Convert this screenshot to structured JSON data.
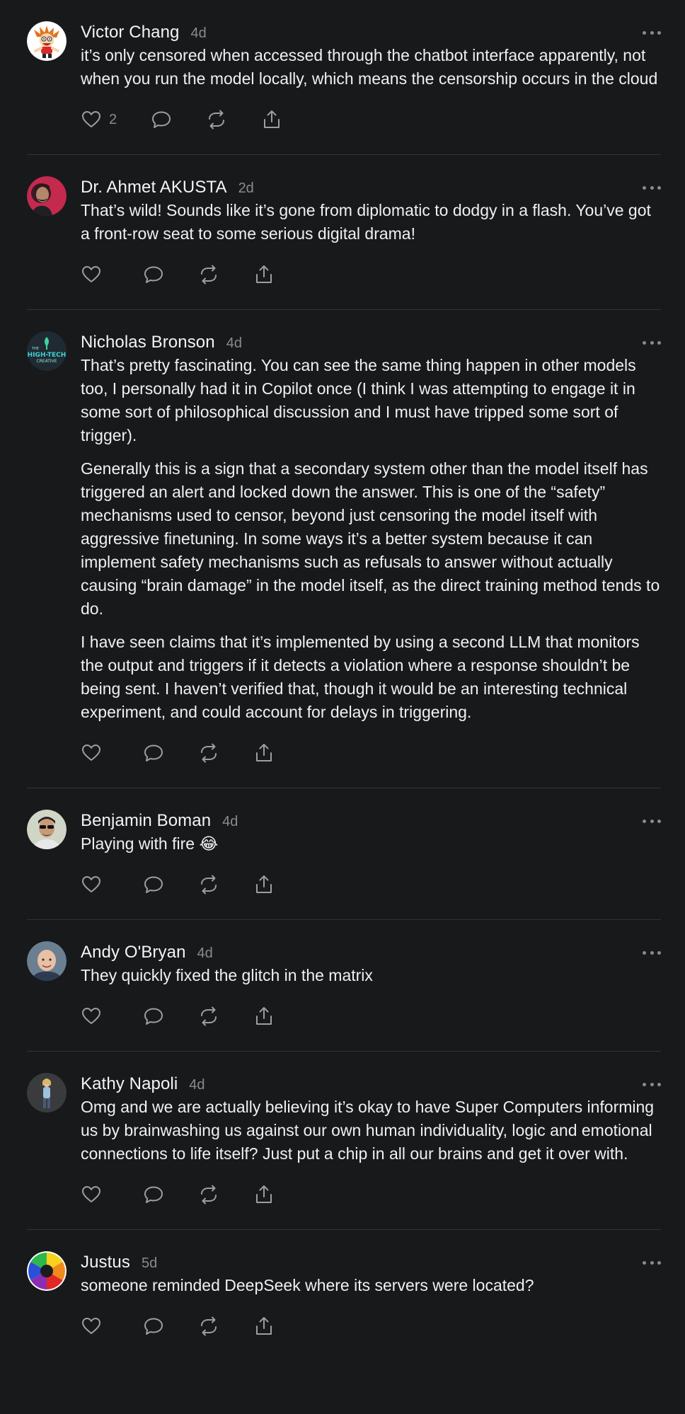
{
  "comments": [
    {
      "author": "Victor Chang",
      "time": "4d",
      "paragraphs": [
        "it’s only censored when accessed through the chatbot interface apparently, not when you run the model locally, which means the censorship occurs in the cloud"
      ],
      "likes": "2",
      "avatar_icon": "cartoon-character-avatar"
    },
    {
      "author": "Dr. Ahmet AKUSTA",
      "time": "2d",
      "paragraphs": [
        "That’s wild! Sounds like it’s gone from diplomatic to dodgy in a flash. You’ve got a front-row seat to some serious digital drama!"
      ],
      "likes": "",
      "avatar_icon": "person-photo-avatar"
    },
    {
      "author": "Nicholas Bronson",
      "time": "4d",
      "paragraphs": [
        "That’s pretty fascinating. You can see the same thing happen in other models too, I personally had it in Copilot once (I think I was attempting to engage it in some sort of philosophical discussion and I must have tripped some sort of trigger).",
        "Generally this is a sign that a secondary system other than the model itself has triggered an alert and locked down the answer. This is one of the “safety” mechanisms used to censor, beyond just censoring the model itself with aggressive finetuning. In some ways it’s a better system because it can implement safety mechanisms such as refusals to answer without actually causing “brain damage” in the model itself, as the direct training method tends to do.",
        "I have seen claims that it’s implemented by using a second LLM that monitors the output and triggers if it detects a violation where a response shouldn’t be being sent. I haven’t verified that, though it would be an interesting technical experiment, and could account for delays in triggering."
      ],
      "likes": "",
      "avatar_icon": "logo-avatar",
      "avatar_logo": {
        "line1": "THE",
        "line2": "HIGH-TECH",
        "line3": "CREATIVE"
      }
    },
    {
      "author": "Benjamin Boman",
      "time": "4d",
      "paragraphs": [
        "Playing with fire 😂"
      ],
      "likes": "",
      "avatar_icon": "person-photo-avatar"
    },
    {
      "author": "Andy O'Bryan",
      "time": "4d",
      "paragraphs": [
        "They quickly fixed the glitch in the matrix"
      ],
      "likes": "",
      "avatar_icon": "person-photo-avatar"
    },
    {
      "author": "Kathy Napoli",
      "time": "4d",
      "paragraphs": [
        "Omg and we are actually believing it’s okay to have Super Computers informing us by brainwashing us against our own human individuality, logic and emotional connections to life itself? Just put a chip in all our brains and get it over with."
      ],
      "likes": "",
      "avatar_icon": "person-photo-avatar"
    },
    {
      "author": "Justus",
      "time": "5d",
      "paragraphs": [
        "someone reminded DeepSeek where its servers were located?"
      ],
      "likes": "",
      "avatar_icon": "color-wheel-avatar"
    }
  ],
  "colors": {
    "background": "#18191b",
    "text": "#f0f0f0",
    "muted": "#8a8b8d",
    "divider": "#323335"
  },
  "icons": [
    "heart-icon",
    "comment-icon",
    "repost-icon",
    "share-icon",
    "more-icon"
  ]
}
